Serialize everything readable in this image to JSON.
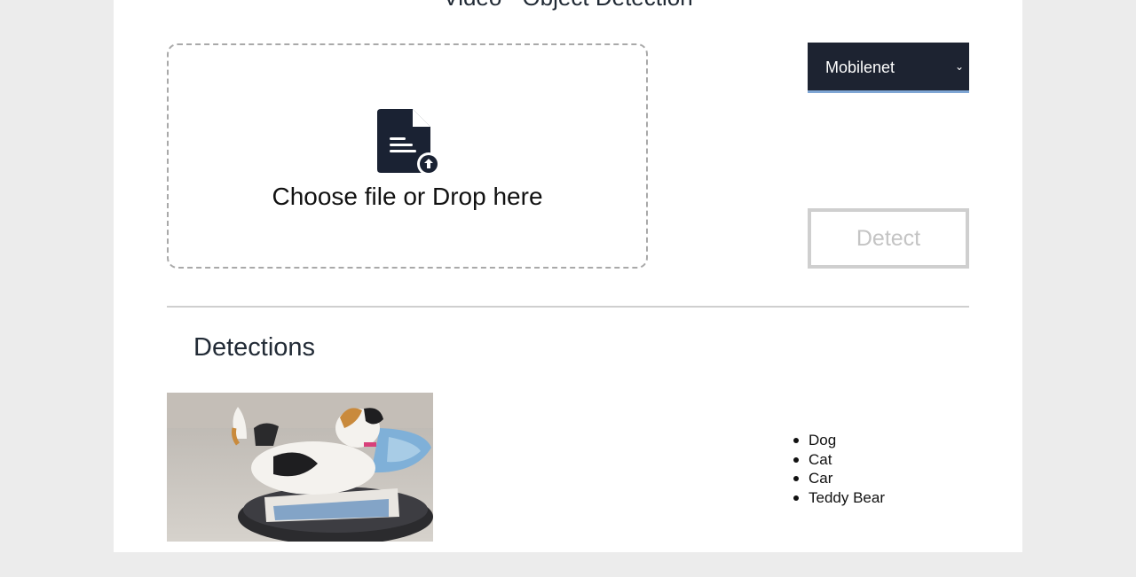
{
  "page": {
    "title": "Video - Object Detection"
  },
  "upload": {
    "label": "Choose file or Drop here",
    "icon": "file-upload-icon"
  },
  "model_select": {
    "selected": "Mobilenet",
    "icon": "chevron-down-icon"
  },
  "detect_button": {
    "label": "Detect",
    "state": "disabled"
  },
  "detections": {
    "heading": "Detections",
    "items": [
      "Dog",
      "Cat",
      "Car",
      "Teddy Bear"
    ]
  },
  "colors": {
    "page_background": "#ececec",
    "panel_background": "#ffffff",
    "select_background": "#1d2331",
    "select_underline": "#7fa6d4",
    "icon_color": "#1a2233",
    "disabled_border": "#cfcfcf"
  }
}
